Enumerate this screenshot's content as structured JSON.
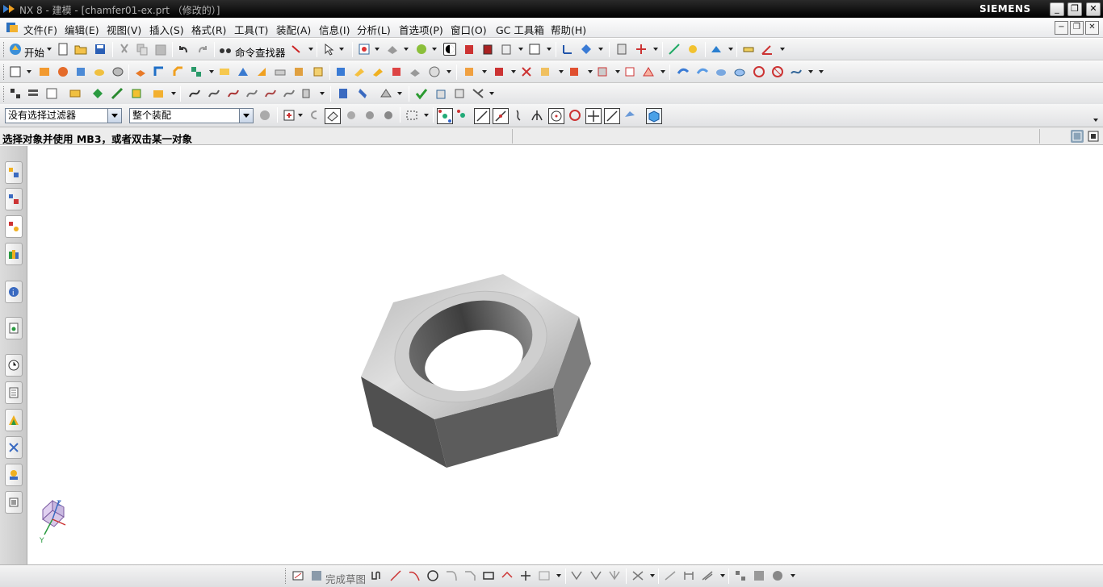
{
  "window": {
    "title": "NX 8 - 建模 - [chamfer01-ex.prt （修改的）]",
    "brand": "SIEMENS",
    "controls": [
      "_",
      "❐",
      "✕"
    ]
  },
  "menu": {
    "items": [
      "文件(F)",
      "编辑(E)",
      "视图(V)",
      "插入(S)",
      "格式(R)",
      "工具(T)",
      "装配(A)",
      "信息(I)",
      "分析(L)",
      "首选项(P)",
      "窗口(O)",
      "GC 工具箱",
      "帮助(H)"
    ],
    "mdi_controls": [
      "−",
      "❐",
      "✕"
    ]
  },
  "toolbar1": {
    "start_label": "开始",
    "command_finder_label": "命令查找器"
  },
  "selection_bar": {
    "filter_value": "没有选择过滤器",
    "scope_value": "整个装配"
  },
  "status": {
    "message": "选择对象并使用 MB3，或者双击某一对象"
  },
  "resource_bar": {
    "icons": [
      "assembly-navigator-icon",
      "constraint-navigator-icon",
      "part-navigator-icon",
      "reuse-library-icon",
      "hd3d-tools-icon",
      "web-browser-icon",
      "history-icon",
      "process-studio-icon",
      "visualization-icon",
      "roles-icon",
      "system-materials-icon",
      "pmi-icon"
    ]
  },
  "sketch_toolbar": {
    "finish_label": "完成草图"
  },
  "colors": {
    "titlebar": "#000000",
    "toolbar": "#e6e7e9",
    "canvas": "#ffffff",
    "nut_top": "#d6d6d6",
    "nut_side_dark": "#4f4f4f",
    "nut_side_mid": "#7a7a7a"
  },
  "triad": {
    "z": "Z",
    "y": "Y"
  }
}
